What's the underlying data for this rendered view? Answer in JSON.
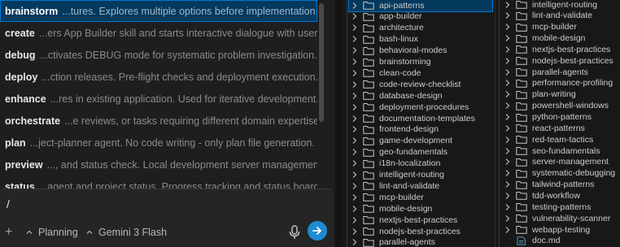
{
  "commands": [
    {
      "name": "brainstorm",
      "desc": "...tures. Explores multiple options before implementation.",
      "selected": true
    },
    {
      "name": "create",
      "desc": "...ers App Builder skill and starts interactive dialogue with user."
    },
    {
      "name": "debug",
      "desc": "...ctivates DEBUG mode for systematic problem investigation."
    },
    {
      "name": "deploy",
      "desc": "...ction releases. Pre-flight checks and deployment execution."
    },
    {
      "name": "enhance",
      "desc": "...res in existing application. Used for iterative development."
    },
    {
      "name": "orchestrate",
      "desc": "...e reviews, or tasks requiring different domain expertise."
    },
    {
      "name": "plan",
      "desc": "...ject-planner agent. No code writing - only plan file generation."
    },
    {
      "name": "preview",
      "desc": "..., and status check. Local development server management."
    },
    {
      "name": "status",
      "desc": "...agent and project status. Progress tracking and status board."
    }
  ],
  "input": {
    "text": "/",
    "mode_label": "Planning",
    "model_label": "Gemini 3 Flash"
  },
  "tree_mid": [
    {
      "label": "api-patterns",
      "selected": true
    },
    {
      "label": "app-builder"
    },
    {
      "label": "architecture"
    },
    {
      "label": "bash-linux"
    },
    {
      "label": "behavioral-modes"
    },
    {
      "label": "brainstorming"
    },
    {
      "label": "clean-code"
    },
    {
      "label": "code-review-checklist"
    },
    {
      "label": "database-design"
    },
    {
      "label": "deployment-procedures"
    },
    {
      "label": "documentation-templates"
    },
    {
      "label": "frontend-design"
    },
    {
      "label": "game-development"
    },
    {
      "label": "geo-fundamentals"
    },
    {
      "label": "i18n-localization"
    },
    {
      "label": "intelligent-routing"
    },
    {
      "label": "lint-and-validate"
    },
    {
      "label": "mcp-builder"
    },
    {
      "label": "mobile-design"
    },
    {
      "label": "nextjs-best-practices"
    },
    {
      "label": "nodejs-best-practices"
    },
    {
      "label": "parallel-agents"
    }
  ],
  "tree_right": [
    {
      "label": "intelligent-routing",
      "type": "folder"
    },
    {
      "label": "lint-and-validate",
      "type": "folder"
    },
    {
      "label": "mcp-builder",
      "type": "folder"
    },
    {
      "label": "mobile-design",
      "type": "folder"
    },
    {
      "label": "nextjs-best-practices",
      "type": "folder"
    },
    {
      "label": "nodejs-best-practices",
      "type": "folder"
    },
    {
      "label": "parallel-agents",
      "type": "folder"
    },
    {
      "label": "performance-profiling",
      "type": "folder"
    },
    {
      "label": "plan-writing",
      "type": "folder"
    },
    {
      "label": "powershell-windows",
      "type": "folder"
    },
    {
      "label": "python-patterns",
      "type": "folder"
    },
    {
      "label": "react-patterns",
      "type": "folder"
    },
    {
      "label": "red-team-tactics",
      "type": "folder"
    },
    {
      "label": "seo-fundamentals",
      "type": "folder"
    },
    {
      "label": "server-management",
      "type": "folder"
    },
    {
      "label": "systematic-debugging",
      "type": "folder"
    },
    {
      "label": "tailwind-patterns",
      "type": "folder"
    },
    {
      "label": "tdd-workflow",
      "type": "folder"
    },
    {
      "label": "testing-patterns",
      "type": "folder"
    },
    {
      "label": "vulnerability-scanner",
      "type": "folder"
    },
    {
      "label": "webapp-testing",
      "type": "folder"
    },
    {
      "label": "doc.md",
      "type": "file"
    }
  ],
  "colors": {
    "accent": "#0078d4",
    "selection": "#04395e",
    "send_button": "#1f8ad2",
    "file_icon": "#519aba"
  },
  "icons": {
    "add": "plus-icon",
    "mode": "chevron-up-icon",
    "mic": "microphone-icon",
    "send": "arrow-right-icon",
    "folder": "folder-icon",
    "file": "file-icon",
    "chevron": "chevron-right-icon"
  }
}
